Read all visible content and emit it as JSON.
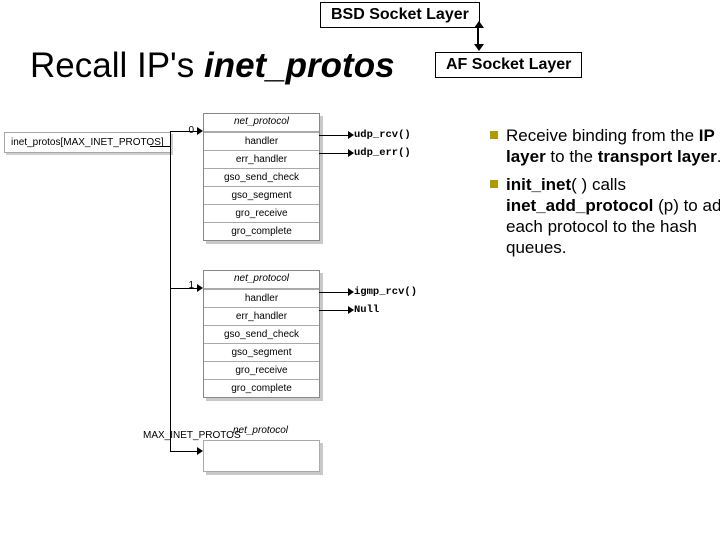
{
  "layers": {
    "bsd": "BSD Socket Layer",
    "af": "AF Socket Layer"
  },
  "title_prefix": "Recall IP's ",
  "title_code": "inet_protos",
  "array_label": "inet_protos[MAX_INET_PROTOS]",
  "struct_header": "net_protocol",
  "fields": [
    "handler",
    "err_handler",
    "gso_send_check",
    "gso_segment",
    "gro_receive",
    "gro_complete"
  ],
  "entries": [
    {
      "index": "0",
      "callbacks": [
        "udp_rcv()",
        "udp_err()"
      ]
    },
    {
      "index": "1",
      "callbacks": [
        "igmp_rcv()",
        "Null"
      ]
    }
  ],
  "last_index": "MAX_INET_PROTOS",
  "bullets": [
    {
      "plain1": "Receive binding from the ",
      "bold": "IP layer",
      "plain2": " to the ",
      "bold2": "transport layer",
      "plain3": "."
    },
    {
      "bold": "init_inet",
      "plain1": "( ) calls ",
      "bold2": "inet_add_protocol",
      "plain2": " (p) to add each protocol to the hash queues."
    }
  ]
}
